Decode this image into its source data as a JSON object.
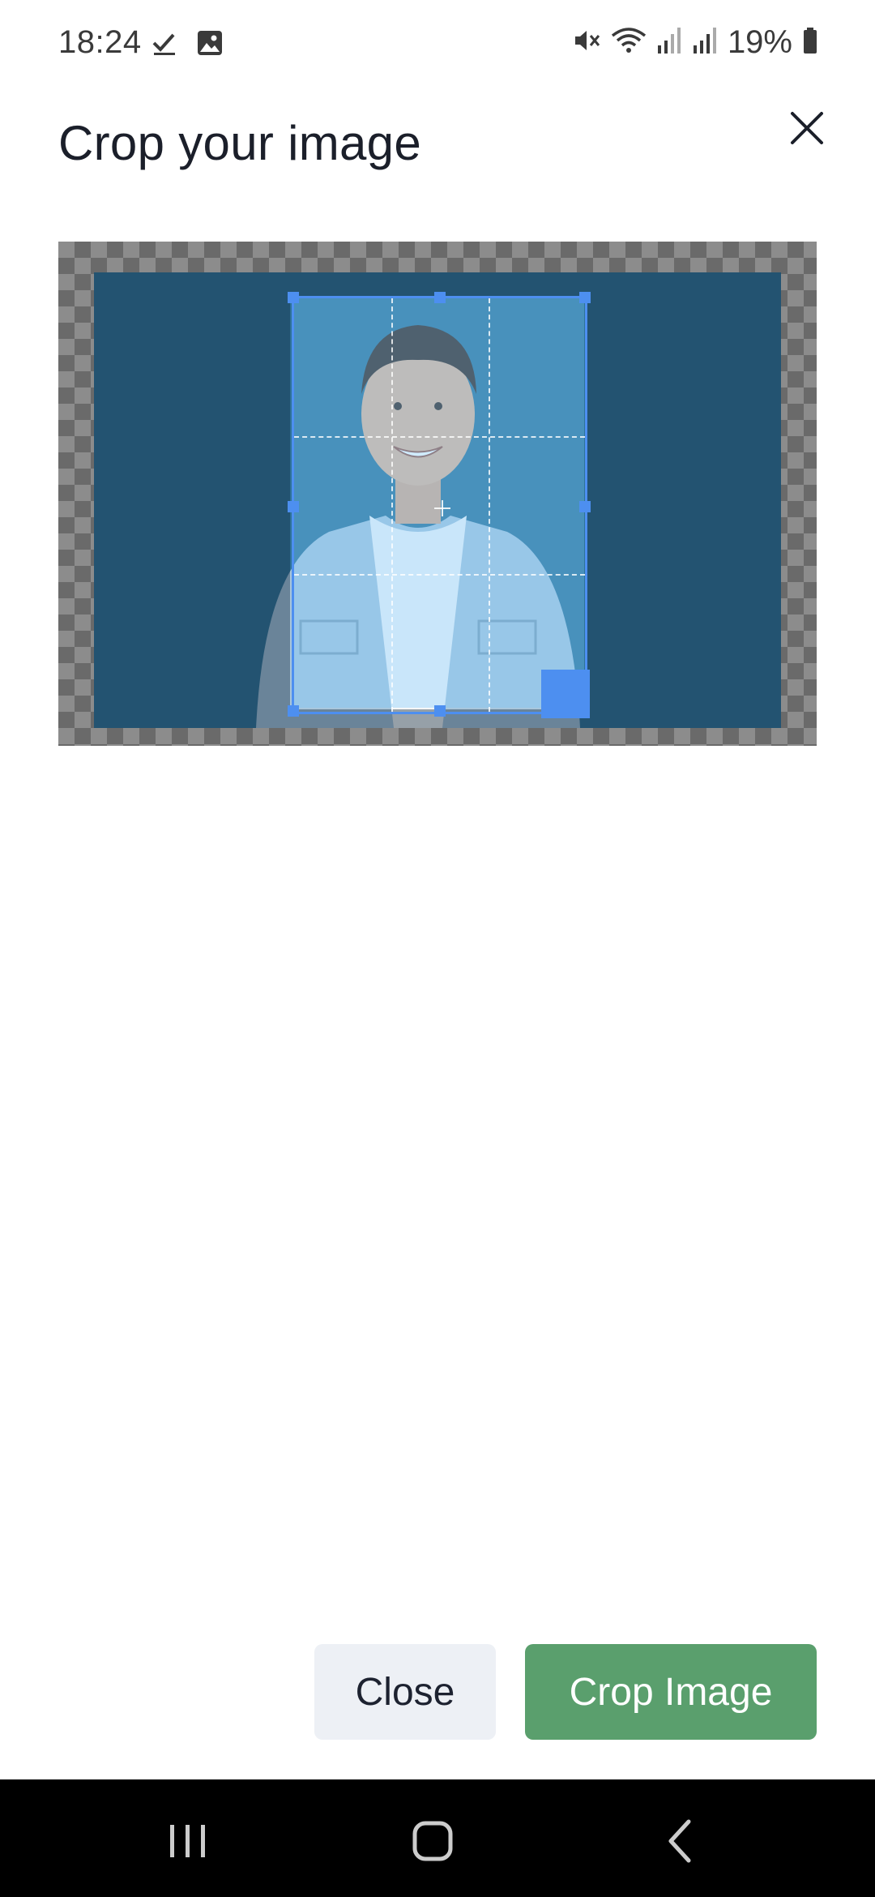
{
  "status_bar": {
    "time": "18:24",
    "battery": "19%",
    "left_icons": [
      "check-icon",
      "image-icon"
    ],
    "right_icons": [
      "mute-icon",
      "wifi-icon",
      "signal-icon",
      "signal-icon-2",
      "battery-icon"
    ]
  },
  "dialog": {
    "title": "Crop your image",
    "close_icon": "close-icon"
  },
  "crop": {
    "aspect_note": ""
  },
  "buttons": {
    "close_label": "Close",
    "crop_label": "Crop Image"
  },
  "colors": {
    "accent_blue": "#4d8ff0",
    "crop_button": "#5a9f6d",
    "close_button": "#edf0f5",
    "photo_background": "#2f6f91"
  },
  "nav": {
    "icons": [
      "recent-apps-icon",
      "home-icon",
      "back-icon"
    ]
  }
}
